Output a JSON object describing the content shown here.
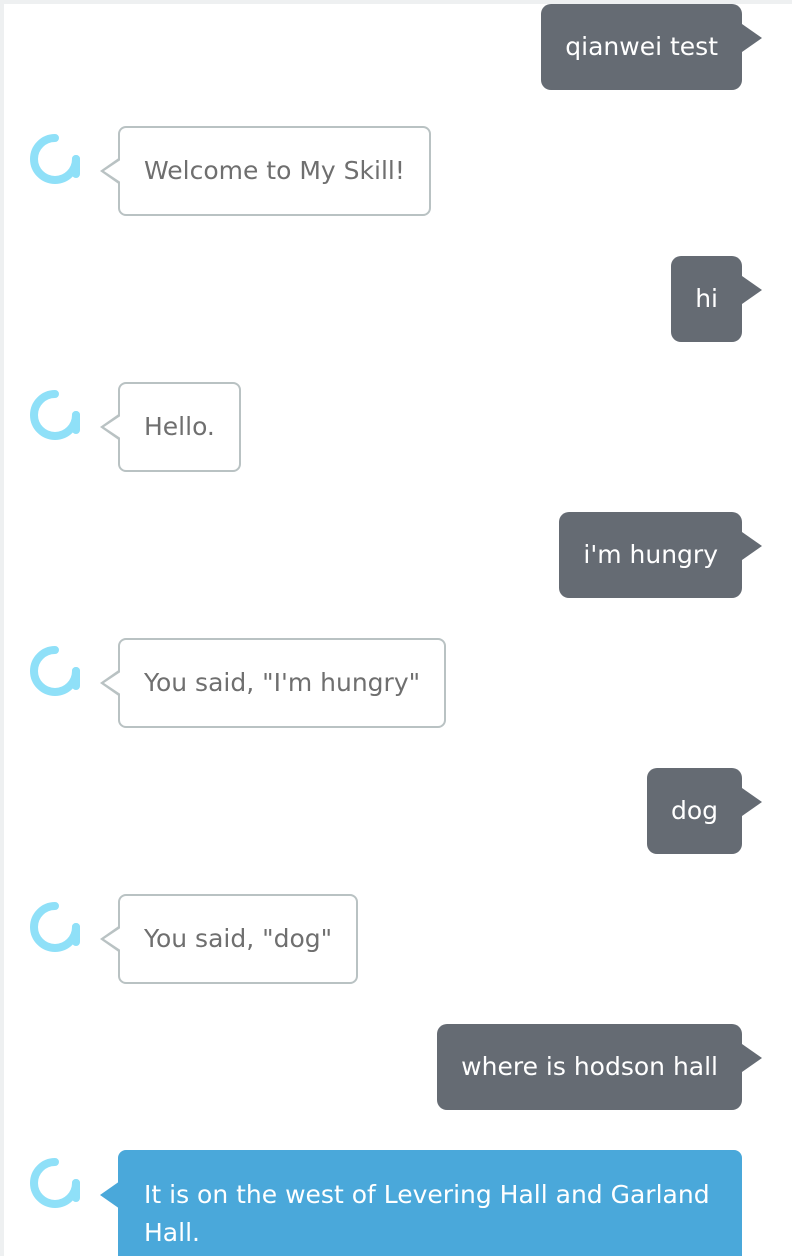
{
  "colors": {
    "user_bubble": "#656b73",
    "alexa_bubble_border": "#b9c2c3",
    "alexa_active_bubble": "#4aa8da",
    "alexa_icon": "#8fe0f8"
  },
  "icons": {
    "alexa": "alexa-ring-icon"
  },
  "conversation": [
    {
      "role": "user",
      "text": "qianwei test"
    },
    {
      "role": "alexa",
      "text": "Welcome to My Skill!"
    },
    {
      "role": "user",
      "text": "hi"
    },
    {
      "role": "alexa",
      "text": "Hello."
    },
    {
      "role": "user",
      "text": "i'm hungry"
    },
    {
      "role": "alexa",
      "text": "You said, \"I'm hungry\""
    },
    {
      "role": "user",
      "text": "dog"
    },
    {
      "role": "alexa",
      "text": "You said, \"dog\""
    },
    {
      "role": "user",
      "text": "where is hodson hall"
    },
    {
      "role": "alexa",
      "text": "It is on the west of Levering Hall and Garland Hall."
    }
  ]
}
